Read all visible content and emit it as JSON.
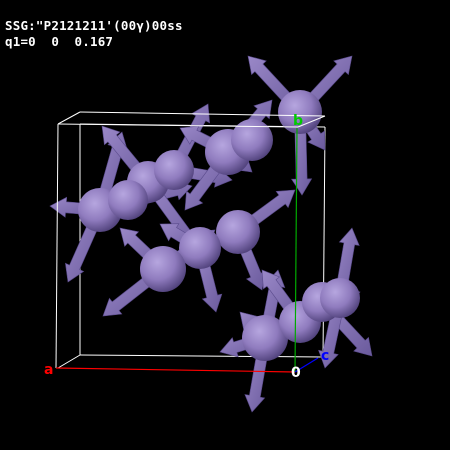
{
  "header": {
    "ssg_line": "SSG:\"P2121211'(00γ)00ss",
    "q_line": "q1=0  0  0.167"
  },
  "axes": {
    "a": {
      "label": "a",
      "color": "#ff0000"
    },
    "b": {
      "label": "b",
      "color": "#00cc00"
    },
    "c": {
      "label": "c",
      "color": "#0000ff"
    },
    "origin": {
      "label": "0",
      "color": "#ffffff"
    }
  },
  "colors": {
    "atom": "#8f7bbe",
    "atom_dark": "#4d3f78",
    "spin": "#7f6cb0",
    "cell_edge": "#ffffff",
    "background": "#000000"
  }
}
